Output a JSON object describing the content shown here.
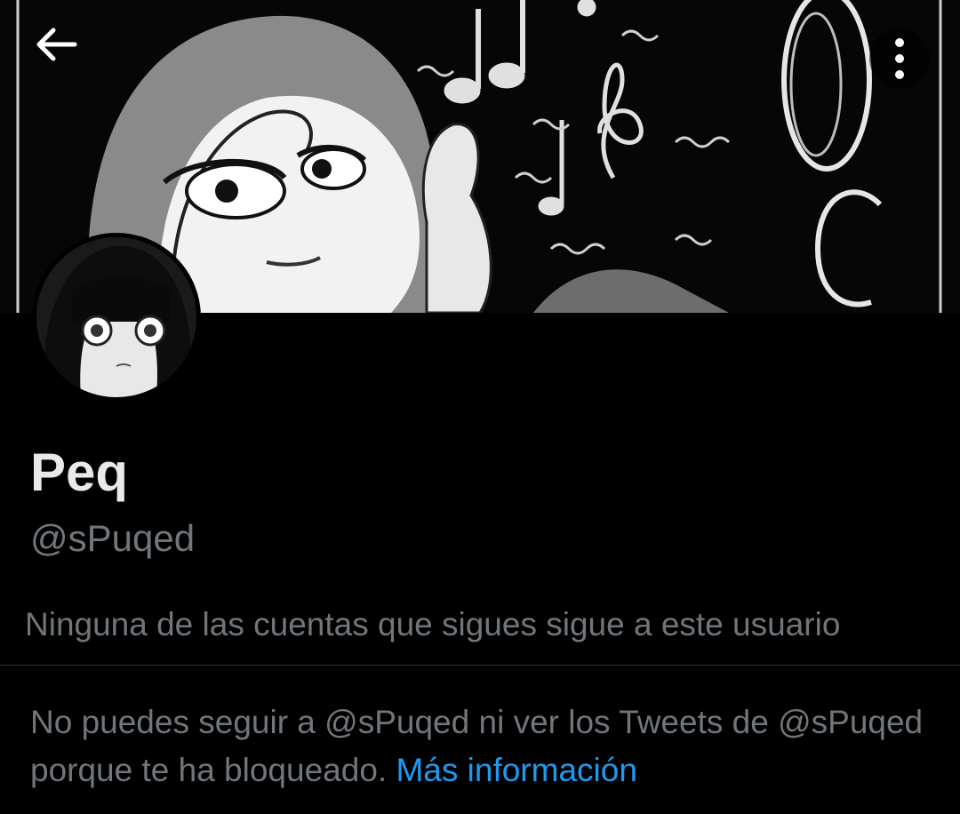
{
  "header": {
    "back_icon": "arrow-left-icon",
    "more_icon": "more-vertical-icon"
  },
  "profile": {
    "display_name": "Peq",
    "handle": "@sPuqed",
    "follow_context": "Ninguna de las cuentas que sigues sigue a este usuario"
  },
  "blocked": {
    "message": "No puedes seguir a @sPuqed ni ver los Tweets de @sPuqed porque te ha bloqueado.",
    "link_label": "Más información"
  },
  "colors": {
    "background": "#000000",
    "primary_text": "#e7e9ea",
    "secondary_text": "#71767b",
    "link": "#1d9bf0",
    "divider": "#2f3336"
  }
}
